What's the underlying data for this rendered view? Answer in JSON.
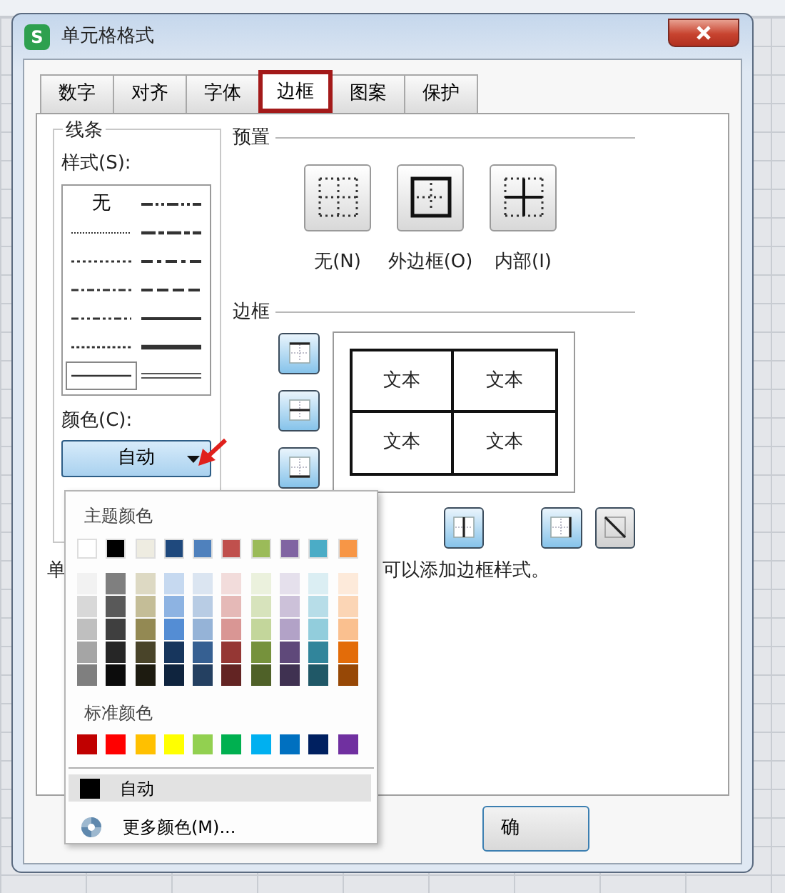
{
  "window": {
    "app_icon": "S",
    "title": "单元格格式"
  },
  "tabs": [
    {
      "label": "数字",
      "selected": false,
      "highlighted": false
    },
    {
      "label": "对齐",
      "selected": false,
      "highlighted": false
    },
    {
      "label": "字体",
      "selected": false,
      "highlighted": false
    },
    {
      "label": "边框",
      "selected": true,
      "highlighted": true
    },
    {
      "label": "图案",
      "selected": false,
      "highlighted": false
    },
    {
      "label": "保护",
      "selected": false,
      "highlighted": false
    }
  ],
  "line_group": {
    "title": "线条",
    "style_label": "样式(S):",
    "styles": [
      {
        "kind": "none",
        "label": "无",
        "selected": false
      },
      {
        "kind": "medium-dash-dot-dot",
        "selected": false
      },
      {
        "kind": "hair",
        "selected": false
      },
      {
        "kind": "slant-dash-dot",
        "selected": false
      },
      {
        "kind": "dotted",
        "selected": false
      },
      {
        "kind": "medium-dash-dot",
        "selected": false
      },
      {
        "kind": "dash-dot",
        "selected": false
      },
      {
        "kind": "medium-dashed",
        "selected": false
      },
      {
        "kind": "dash-dot-dot",
        "selected": false
      },
      {
        "kind": "medium",
        "selected": false
      },
      {
        "kind": "dots",
        "selected": false
      },
      {
        "kind": "thick",
        "selected": false
      },
      {
        "kind": "thin",
        "selected": true
      },
      {
        "kind": "double",
        "selected": false
      }
    ]
  },
  "color": {
    "label": "颜色(C):",
    "value": "自动",
    "annotated": true
  },
  "presets": {
    "title": "预置",
    "buttons": [
      {
        "kind": "none",
        "label": "无(N)"
      },
      {
        "kind": "outline",
        "label": "外边框(O)"
      },
      {
        "kind": "inside",
        "label": "内部(I)"
      }
    ]
  },
  "border": {
    "title": "边框",
    "side_buttons": [
      {
        "kind": "top",
        "on": true
      },
      {
        "kind": "middle-h",
        "on": true
      },
      {
        "kind": "bottom",
        "on": true
      }
    ],
    "preview": [
      "文本",
      "文本",
      "文本",
      "文本"
    ],
    "bottom_buttons": [
      {
        "kind": "middle-v",
        "on": true
      },
      {
        "kind": "right",
        "on": true
      },
      {
        "kind": "diagonal-down",
        "on": false
      }
    ]
  },
  "hint": [
    "单",
    "可以添加边框样式。"
  ],
  "color_popup": {
    "theme_title": "主题颜色",
    "theme": [
      {
        "color": "#ffffff"
      },
      {
        "color": "#000000"
      },
      {
        "color": "#eeece1"
      },
      {
        "color": "#1f497d"
      },
      {
        "color": "#4f81bd"
      },
      {
        "color": "#c0504d"
      },
      {
        "color": "#9bbb59"
      },
      {
        "color": "#8064a2"
      },
      {
        "color": "#4bacc6"
      },
      {
        "color": "#f79646"
      }
    ],
    "shades": [
      [
        {
          "color": "#f2f2f2"
        },
        {
          "color": "#7f7f7f"
        },
        {
          "color": "#ddd9c3"
        },
        {
          "color": "#c6d9f0"
        },
        {
          "color": "#dbe5f1"
        },
        {
          "color": "#f2dcdb"
        },
        {
          "color": "#ebf1dd"
        },
        {
          "color": "#e5e0ec"
        },
        {
          "color": "#dbeef3"
        },
        {
          "color": "#fdeada"
        }
      ],
      [
        {
          "color": "#d8d8d8"
        },
        {
          "color": "#595959"
        },
        {
          "color": "#c4bd97"
        },
        {
          "color": "#8db3e2"
        },
        {
          "color": "#b8cce4"
        },
        {
          "color": "#e5b9b7"
        },
        {
          "color": "#d7e3bc"
        },
        {
          "color": "#ccc1d9"
        },
        {
          "color": "#b7dde8"
        },
        {
          "color": "#fbd5b5"
        }
      ],
      [
        {
          "color": "#bfbfbf"
        },
        {
          "color": "#3f3f3f"
        },
        {
          "color": "#938953"
        },
        {
          "color": "#548dd4"
        },
        {
          "color": "#95b3d7"
        },
        {
          "color": "#d99694"
        },
        {
          "color": "#c3d69b"
        },
        {
          "color": "#b2a2c7"
        },
        {
          "color": "#92cddc"
        },
        {
          "color": "#fac08f"
        }
      ],
      [
        {
          "color": "#a5a5a5"
        },
        {
          "color": "#262626"
        },
        {
          "color": "#494429"
        },
        {
          "color": "#17365d"
        },
        {
          "color": "#366092"
        },
        {
          "color": "#953734"
        },
        {
          "color": "#76923c"
        },
        {
          "color": "#5f497a"
        },
        {
          "color": "#31859b"
        },
        {
          "color": "#e36c09"
        }
      ],
      [
        {
          "color": "#7f7f7f"
        },
        {
          "color": "#0c0c0c"
        },
        {
          "color": "#1d1b10"
        },
        {
          "color": "#0f243e"
        },
        {
          "color": "#244061"
        },
        {
          "color": "#632423"
        },
        {
          "color": "#4f6128"
        },
        {
          "color": "#3f3151"
        },
        {
          "color": "#205867"
        },
        {
          "color": "#974806"
        }
      ]
    ],
    "standard_title": "标准颜色",
    "standard": [
      {
        "color": "#c00000"
      },
      {
        "color": "#ff0000"
      },
      {
        "color": "#ffc000"
      },
      {
        "color": "#ffff00"
      },
      {
        "color": "#92d050"
      },
      {
        "color": "#00b050"
      },
      {
        "color": "#00b0f0"
      },
      {
        "color": "#0070c0"
      },
      {
        "color": "#002060"
      },
      {
        "color": "#7030a0"
      }
    ],
    "items": [
      {
        "kind": "auto",
        "label": "自动",
        "selected": true
      },
      {
        "kind": "more",
        "label": "更多颜色(M)...",
        "selected": false
      }
    ]
  },
  "footer_buttons": [
    "确"
  ]
}
